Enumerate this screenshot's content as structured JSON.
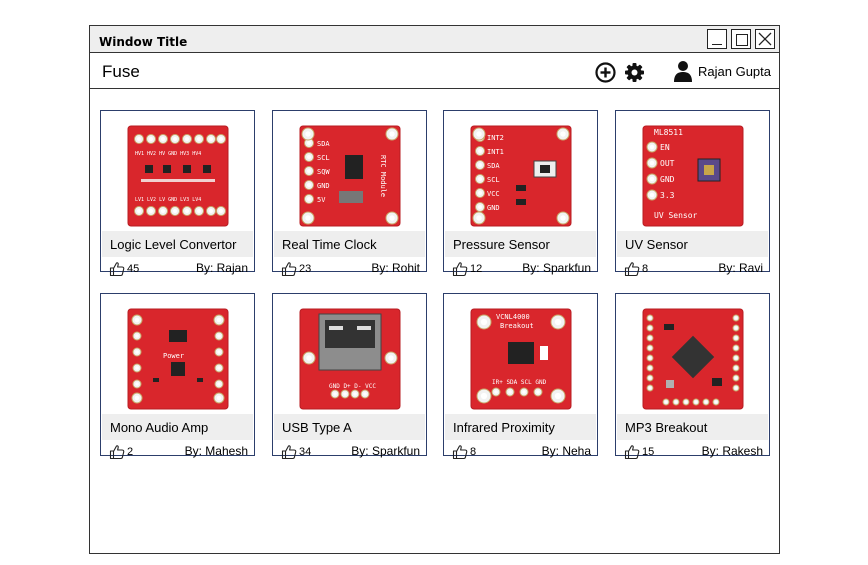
{
  "window": {
    "title": "Window Title"
  },
  "appbar": {
    "app_name": "Fuse",
    "user_name": "Rajan Gupta"
  },
  "icons": {
    "add": "add-circle-icon",
    "settings": "gear-icon",
    "user": "user-icon",
    "like": "thumbs-up-icon"
  },
  "colors": {
    "card_border": "#2c3e6b",
    "board_red": "#d9262c",
    "name_bar": "#eeeeee"
  },
  "cards": [
    {
      "name": "Logic Level Convertor",
      "likes": "45",
      "author": "By: Rajan"
    },
    {
      "name": "Real Time Clock",
      "likes": "23",
      "author": "By: Rohit"
    },
    {
      "name": "Pressure Sensor",
      "likes": "12",
      "author": "By: Sparkfun"
    },
    {
      "name": "UV Sensor",
      "likes": "8",
      "author": "By: Ravi"
    },
    {
      "name": "Mono Audio Amp",
      "likes": "2",
      "author": "By: Mahesh"
    },
    {
      "name": "USB Type A",
      "likes": "34",
      "author": "By: Sparkfun"
    },
    {
      "name": "Infrared Proximity",
      "likes": "8",
      "author": "By: Neha"
    },
    {
      "name": "MP3 Breakout",
      "likes": "15",
      "author": "By: Rakesh"
    }
  ]
}
